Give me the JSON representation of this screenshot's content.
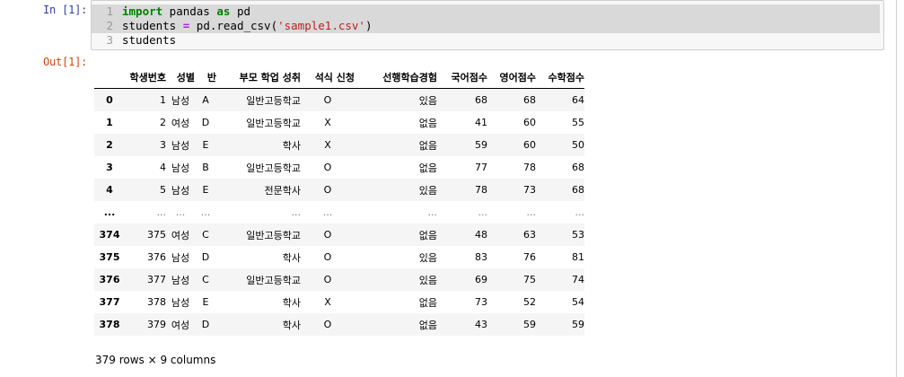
{
  "prompts": {
    "in": "In [1]:",
    "out": "Out[1]:"
  },
  "code": {
    "lines": [
      {
        "num": "1",
        "tokens": [
          {
            "t": "import",
            "c": "kw"
          },
          {
            "t": " pandas ",
            "c": "nm"
          },
          {
            "t": "as",
            "c": "kw"
          },
          {
            "t": " pd",
            "c": "nm"
          }
        ]
      },
      {
        "num": "2",
        "tokens": [
          {
            "t": "students ",
            "c": "nm"
          },
          {
            "t": "=",
            "c": "op"
          },
          {
            "t": " pd.read_csv(",
            "c": "nm"
          },
          {
            "t": "'sample1.csv'",
            "c": "str"
          },
          {
            "t": ")",
            "c": "nm"
          }
        ]
      },
      {
        "num": "3",
        "tokens": [
          {
            "t": "students",
            "c": "nm"
          }
        ]
      }
    ]
  },
  "table": {
    "columns": [
      "학생번호",
      "성별",
      "반",
      "부모 학업 성취",
      "석식 신청",
      "선행학습경험",
      "국어점수",
      "영어점수",
      "수학점수"
    ],
    "rows": [
      {
        "index": "0",
        "cells": [
          "1",
          "남성",
          "A",
          "일반고등학교",
          "O",
          "있음",
          "68",
          "68",
          "64"
        ]
      },
      {
        "index": "1",
        "cells": [
          "2",
          "여성",
          "D",
          "일반고등학교",
          "X",
          "없음",
          "41",
          "60",
          "55"
        ]
      },
      {
        "index": "2",
        "cells": [
          "3",
          "남성",
          "E",
          "학사",
          "X",
          "없음",
          "59",
          "60",
          "50"
        ]
      },
      {
        "index": "3",
        "cells": [
          "4",
          "남성",
          "B",
          "일반고등학교",
          "O",
          "없음",
          "77",
          "78",
          "68"
        ]
      },
      {
        "index": "4",
        "cells": [
          "5",
          "남성",
          "E",
          "전문학사",
          "O",
          "있음",
          "78",
          "73",
          "68"
        ]
      },
      {
        "index": "...",
        "cells": [
          "...",
          "...",
          "...",
          "...",
          "...",
          "...",
          "...",
          "...",
          "..."
        ]
      },
      {
        "index": "374",
        "cells": [
          "375",
          "여성",
          "C",
          "일반고등학교",
          "O",
          "없음",
          "48",
          "63",
          "53"
        ]
      },
      {
        "index": "375",
        "cells": [
          "376",
          "남성",
          "D",
          "학사",
          "O",
          "있음",
          "83",
          "76",
          "81"
        ]
      },
      {
        "index": "376",
        "cells": [
          "377",
          "남성",
          "C",
          "일반고등학교",
          "O",
          "있음",
          "69",
          "75",
          "74"
        ]
      },
      {
        "index": "377",
        "cells": [
          "378",
          "남성",
          "E",
          "학사",
          "X",
          "없음",
          "73",
          "52",
          "54"
        ]
      },
      {
        "index": "378",
        "cells": [
          "379",
          "여성",
          "D",
          "학사",
          "O",
          "없음",
          "43",
          "59",
          "59"
        ]
      }
    ]
  },
  "summary": "379 rows × 9 columns"
}
